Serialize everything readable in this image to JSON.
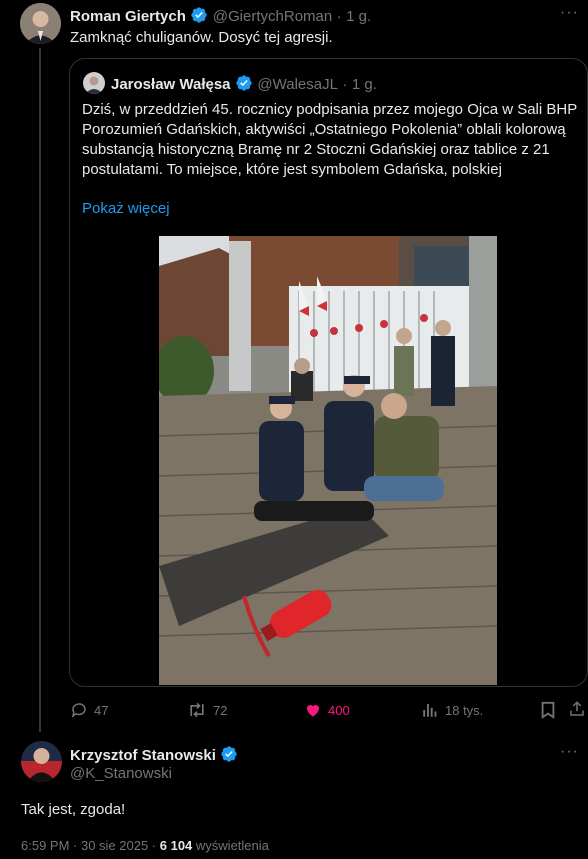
{
  "parent_tweet": {
    "author_name": "Roman Giertych",
    "handle": "@GiertychRoman",
    "separator": "·",
    "time": "1 g.",
    "text": "Zamknąć chuliganów. Dosyć tej agresji."
  },
  "quoted_tweet": {
    "author_name": "Jarosław Wałęsa",
    "handle": "@WalesaJL",
    "separator": "·",
    "time": "1 g.",
    "text": "Dziś, w przeddzień 45. rocznicy podpisania przez mojego Ojca w Sali BHP Porozumień Gdańskich, aktywiści „Ostatniego Pokolenia” oblali kolorową substancją historyczną Bramę nr 2 Stoczni Gdańskiej oraz tablice z 21 postulatami. To miejsce, które jest symbolem Gdańska, polskiej",
    "show_more": "Pokaż więcej"
  },
  "actions": {
    "replies": "47",
    "reposts": "72",
    "likes": "400",
    "views": "18 tys."
  },
  "main_tweet": {
    "author_name": "Krzysztof Stanowski",
    "handle": "@K_Stanowski",
    "text": "Tak jest, zgoda!",
    "timestamp": "6:59 PM · 30 sie 2025 · ",
    "views_count": "6 104",
    "views_label": " wyświetlenia"
  },
  "colors": {
    "background": "#000000",
    "text": "#e7e9ea",
    "muted": "#71767b",
    "accent": "#1d9bf0",
    "like": "#f91880",
    "border": "#2f3336"
  },
  "icons": [
    "verified-badge-icon",
    "reply-icon",
    "repost-icon",
    "like-icon",
    "views-icon",
    "bookmark-icon",
    "share-icon",
    "more-icon"
  ]
}
